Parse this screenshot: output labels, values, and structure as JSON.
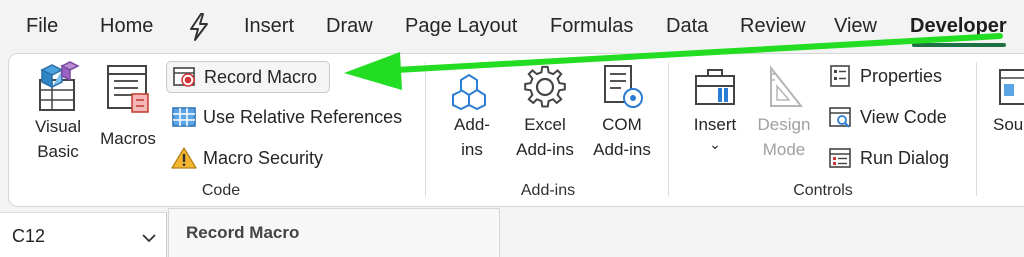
{
  "tabs": [
    {
      "label": "File",
      "active": false
    },
    {
      "label": "Home",
      "active": false
    },
    {
      "label": "Insert",
      "active": false
    },
    {
      "label": "Draw",
      "active": false
    },
    {
      "label": "Page Layout",
      "active": false
    },
    {
      "label": "Formulas",
      "active": false
    },
    {
      "label": "Data",
      "active": false
    },
    {
      "label": "Review",
      "active": false
    },
    {
      "label": "View",
      "active": false
    },
    {
      "label": "Developer",
      "active": true
    }
  ],
  "groups": {
    "code": {
      "label": "Code",
      "visual_basic": {
        "line1": "Visual",
        "line2": "Basic"
      },
      "macros": "Macros",
      "record_macro": "Record Macro",
      "relative_refs": "Use Relative References",
      "macro_security": "Macro Security"
    },
    "addins": {
      "label": "Add-ins",
      "addins": {
        "line1": "Add-",
        "line2": "ins"
      },
      "excel_addins": {
        "line1": "Excel",
        "line2": "Add-ins"
      },
      "com_addins": {
        "line1": "COM",
        "line2": "Add-ins"
      }
    },
    "controls": {
      "label": "Controls",
      "insert": "Insert",
      "insert_chevron": "⌄",
      "design_mode": {
        "line1": "Design",
        "line2": "Mode",
        "enabled": false
      },
      "properties": "Properties",
      "view_code": "View Code",
      "run_dialog": "Run Dialog"
    },
    "partial_next": "Sou"
  },
  "name_box": {
    "value": "C12"
  },
  "tooltip": {
    "title": "Record Macro"
  },
  "colors": {
    "accent": "#1e7145",
    "arrow": "#22dd22",
    "record_red": "#d13438"
  }
}
